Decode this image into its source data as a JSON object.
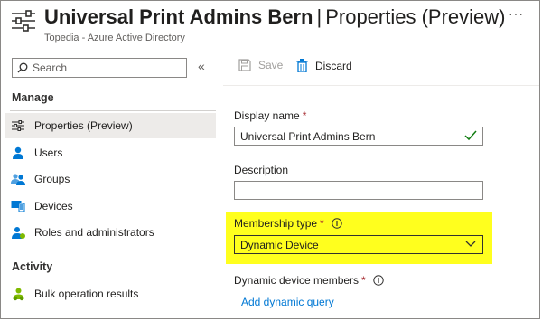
{
  "header": {
    "title_bold": "Universal Print Admins Bern",
    "title_sep": "|",
    "title_rest": "Properties (Preview)",
    "subtitle": "Topedia - Azure Active Directory",
    "more": "···"
  },
  "sidebar": {
    "search_placeholder": "Search",
    "collapse": "«",
    "manage_label": "Manage",
    "items": [
      {
        "label": "Properties (Preview)",
        "icon": "sliders-icon"
      },
      {
        "label": "Users",
        "icon": "user-icon"
      },
      {
        "label": "Groups",
        "icon": "group-icon"
      },
      {
        "label": "Devices",
        "icon": "devices-icon"
      },
      {
        "label": "Roles and administrators",
        "icon": "roles-icon"
      }
    ],
    "activity_label": "Activity",
    "activity_items": [
      {
        "label": "Bulk operation results",
        "icon": "bulk-icon"
      }
    ]
  },
  "toolbar": {
    "save_label": "Save",
    "discard_label": "Discard"
  },
  "form": {
    "display_name_label": "Display name",
    "display_name_value": "Universal Print Admins Bern",
    "description_label": "Description",
    "description_value": "",
    "membership_label": "Membership type",
    "membership_value": "Dynamic Device",
    "dynamic_members_label": "Dynamic device members",
    "add_query_link": "Add dynamic query",
    "required_mark": "*"
  },
  "colors": {
    "accent": "#0078d4",
    "required": "#a4262c",
    "highlight": "#ffff1e",
    "success": "#107c10"
  }
}
